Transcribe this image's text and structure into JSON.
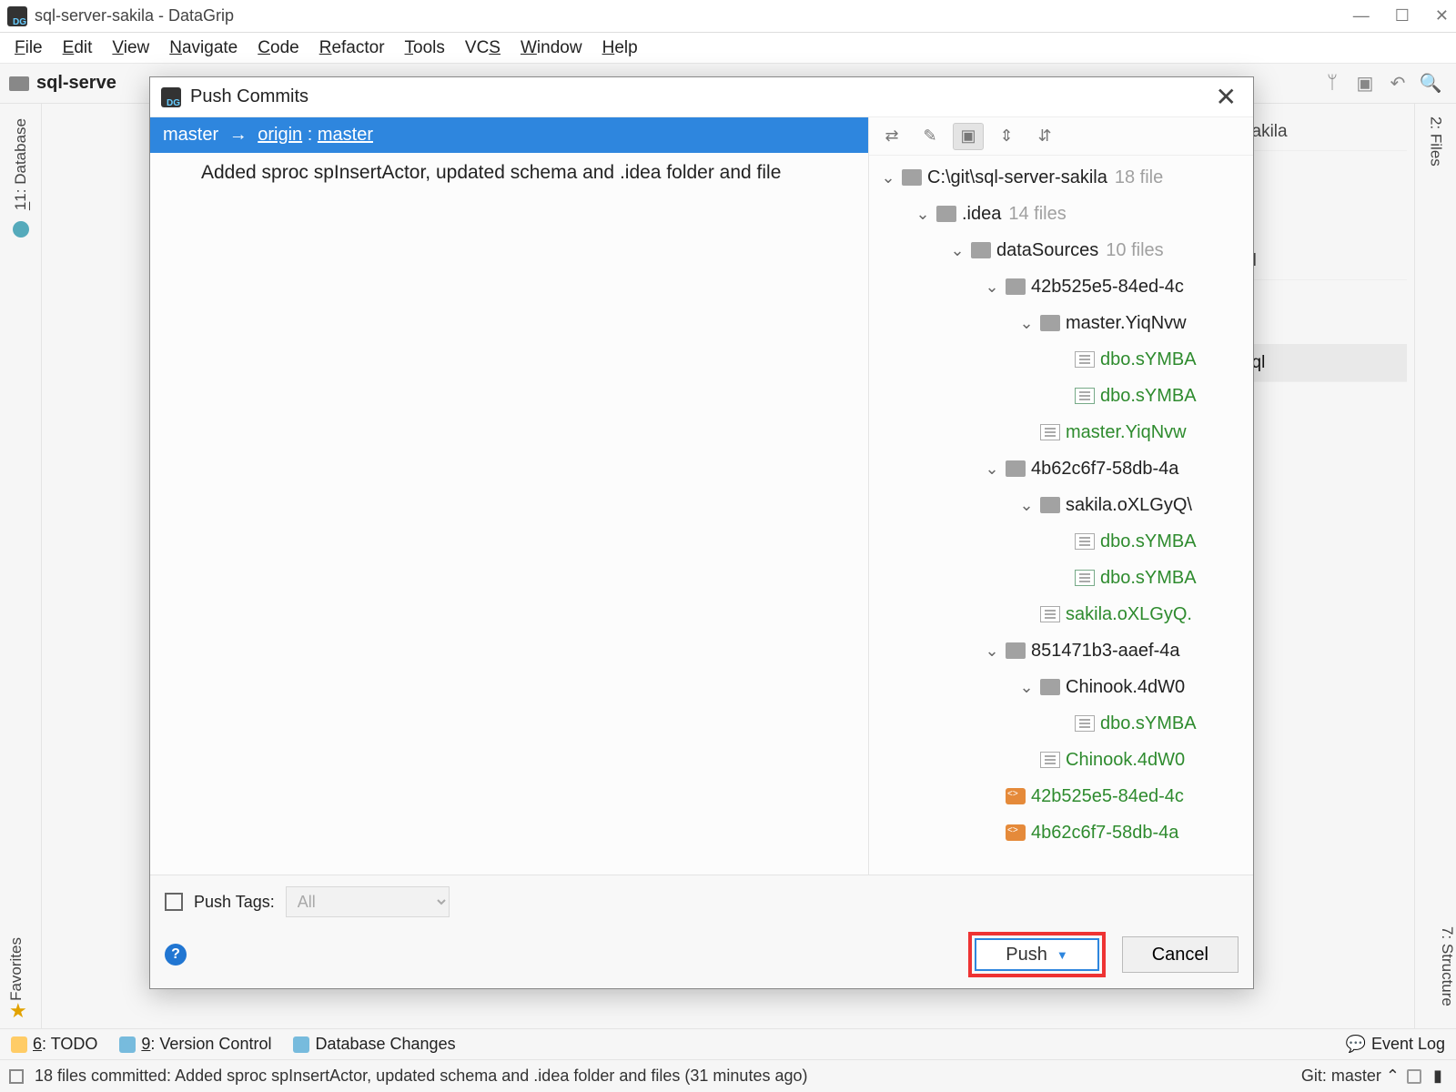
{
  "window_title": "sql-server-sakila - DataGrip",
  "menus": [
    "File",
    "Edit",
    "View",
    "Navigate",
    "Code",
    "Refactor",
    "Tools",
    "VCS",
    "Window",
    "Help"
  ],
  "menu_underlines": [
    "F",
    "E",
    "V",
    "N",
    "C",
    "R",
    "T",
    "S",
    "W",
    "H"
  ],
  "breadcrumb": "sql-serve",
  "left_rail": {
    "database": "1: Database"
  },
  "right_rail": {
    "files": "2: Files",
    "structure": "7: Structure"
  },
  "favorites_label": "Favorites",
  "bottom_bar": {
    "todo": "6: TODO",
    "vcs": "9: Version Control",
    "dbchanges": "Database Changes",
    "eventlog": "Event Log"
  },
  "status": {
    "text": "18 files committed: Added sproc spInsertActor, updated schema and .idea folder and files (31 minutes ago)",
    "git": "Git: master"
  },
  "bg_tabs": [
    "sakila",
    "ql",
    "sql"
  ],
  "dialog": {
    "title": "Push Commits",
    "branch": {
      "local": "master",
      "remote": "origin",
      "remote_branch": "master"
    },
    "commit_message": "Added sproc spInsertActor, updated schema and .idea folder and file",
    "push_tags_label": "Push Tags:",
    "push_tags_option": "All",
    "push_button": "Push",
    "cancel_button": "Cancel",
    "tree": [
      {
        "indent": 0,
        "chev": true,
        "icon": "folder",
        "label": "C:\\git\\sql-server-sakila",
        "count": "18 file",
        "green": false
      },
      {
        "indent": 1,
        "chev": true,
        "icon": "folder",
        "label": ".idea",
        "count": "14 files",
        "green": false
      },
      {
        "indent": 2,
        "chev": true,
        "icon": "folder",
        "label": "dataSources",
        "count": "10 files",
        "green": false
      },
      {
        "indent": 3,
        "chev": true,
        "icon": "folder",
        "label": "42b525e5-84ed-4c",
        "green": false
      },
      {
        "indent": 4,
        "chev": true,
        "icon": "folder",
        "label": "master.YiqNvw",
        "green": false
      },
      {
        "indent": 5,
        "chev": false,
        "icon": "file",
        "label": "dbo.sYMBA",
        "green": true
      },
      {
        "indent": 5,
        "chev": false,
        "icon": "zip",
        "label": "dbo.sYMBA",
        "green": true
      },
      {
        "indent": 4,
        "chev": false,
        "icon": "file",
        "label": "master.YiqNvw",
        "green": true
      },
      {
        "indent": 3,
        "chev": true,
        "icon": "folder",
        "label": "4b62c6f7-58db-4a",
        "green": false
      },
      {
        "indent": 4,
        "chev": true,
        "icon": "folder",
        "label": "sakila.oXLGyQ\\",
        "green": false
      },
      {
        "indent": 5,
        "chev": false,
        "icon": "file",
        "label": "dbo.sYMBA",
        "green": true
      },
      {
        "indent": 5,
        "chev": false,
        "icon": "zip",
        "label": "dbo.sYMBA",
        "green": true
      },
      {
        "indent": 4,
        "chev": false,
        "icon": "file",
        "label": "sakila.oXLGyQ.",
        "green": true
      },
      {
        "indent": 3,
        "chev": true,
        "icon": "folder",
        "label": "851471b3-aaef-4a",
        "green": false
      },
      {
        "indent": 4,
        "chev": true,
        "icon": "folder",
        "label": "Chinook.4dW0",
        "green": false
      },
      {
        "indent": 5,
        "chev": false,
        "icon": "file",
        "label": "dbo.sYMBA",
        "green": true
      },
      {
        "indent": 4,
        "chev": false,
        "icon": "file",
        "label": "Chinook.4dW0",
        "green": true
      },
      {
        "indent": 3,
        "chev": false,
        "icon": "xml",
        "label": "42b525e5-84ed-4c",
        "green": true
      },
      {
        "indent": 3,
        "chev": false,
        "icon": "xml",
        "label": "4b62c6f7-58db-4a",
        "green": true
      }
    ]
  }
}
